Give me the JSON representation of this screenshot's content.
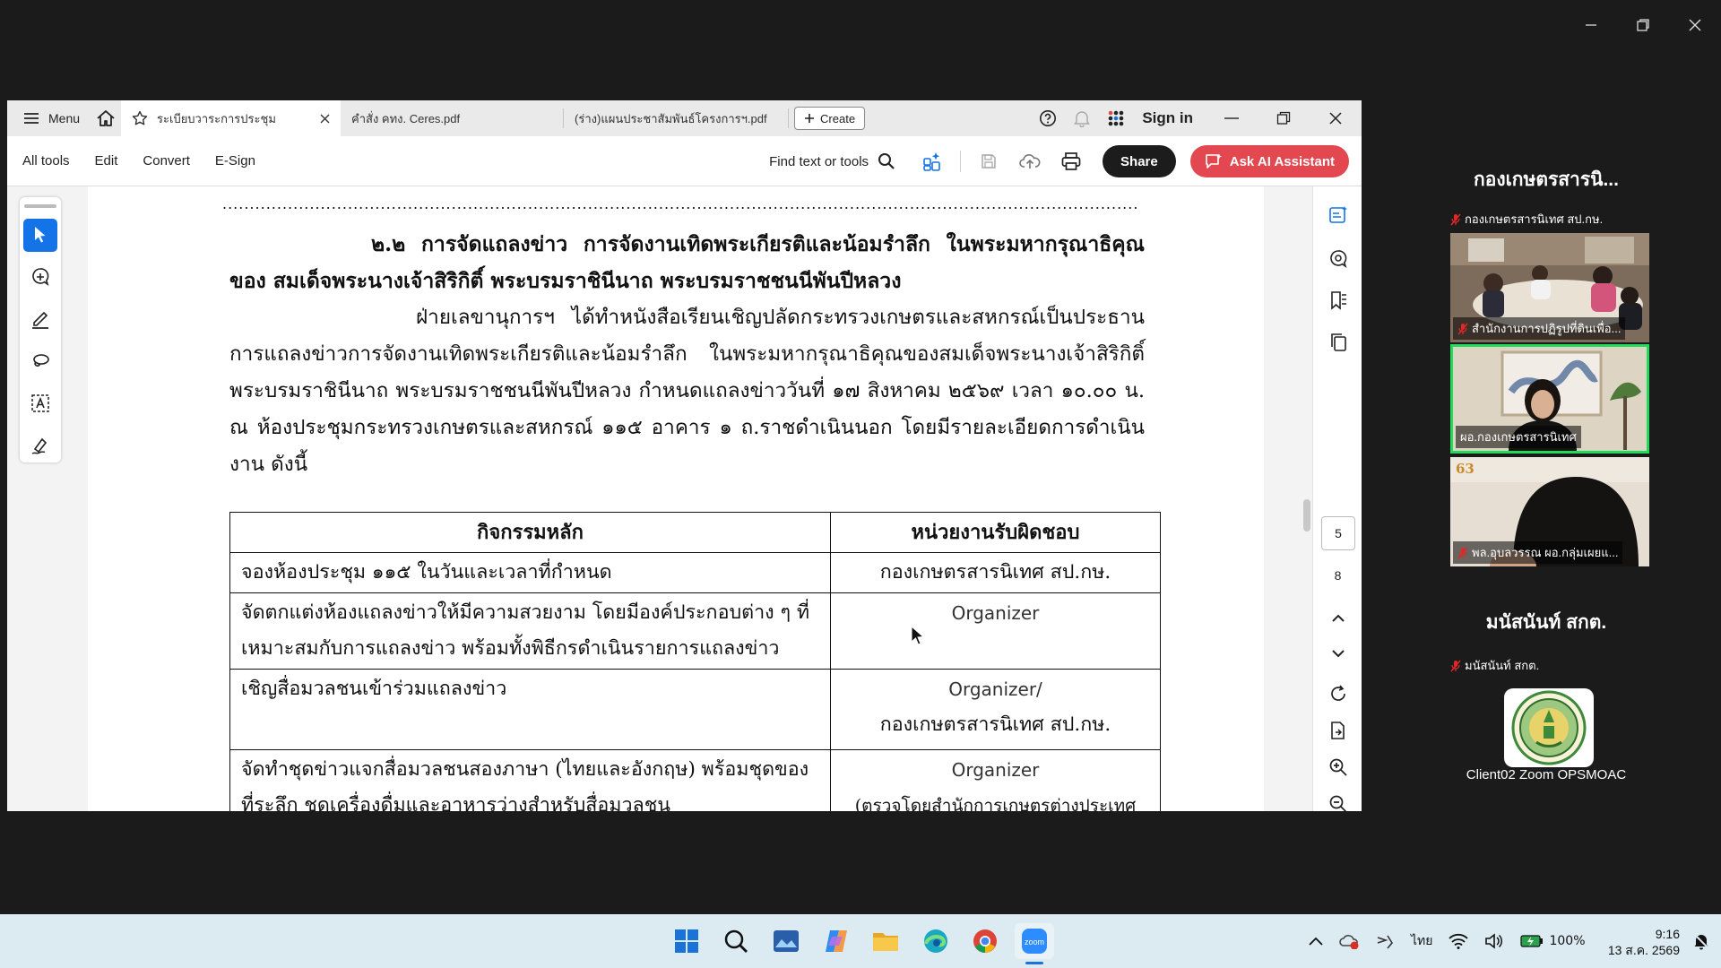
{
  "acrobat": {
    "menu_label": "Menu",
    "tabs": [
      {
        "label": "ระเบียบวาระการประชุม"
      },
      {
        "label": "คำสั่ง คทง. Ceres.pdf"
      },
      {
        "label": "(ร่าง)แผนประชาสัมพันธ์โครงการฯ.pdf"
      }
    ],
    "create_label": "Create",
    "signin_label": "Sign in",
    "menus": [
      "All tools",
      "Edit",
      "Convert",
      "E-Sign"
    ],
    "find_label": "Find text or tools",
    "share_label": "Share",
    "ask_ai_label": "Ask AI Assistant",
    "page_current": "5",
    "page_total": "8"
  },
  "document": {
    "dots": "..........................................................................................................................................................................................................",
    "heading": "๒.๒ การจัดแถลงข่าว การจัดงานเทิดพระเกียรติและน้อมรำลึก ในพระมหากรุณาธิคุณของ สมเด็จพระนางเจ้าสิริกิติ์ พระบรมราชินีนาถ พระบรมราชชนนีพันปีหลวง",
    "paragraph": "ฝ่ายเลขานุการฯ ได้ทำหนังสือเรียนเชิญปลัดกระทรวงเกษตรและสหกรณ์เป็นประธานการแถลงข่าวการจัดงานเทิดพระเกียรติและน้อมรำลึก ในพระมหากรุณาธิคุณของสมเด็จพระนางเจ้าสิริกิติ์ พระบรมราชินีนาถ พระบรมราชชนนีพันปีหลวง กำหนดแถลงข่าววันที่ ๑๗ สิงหาคม ๒๕๖๙ เวลา ๑๐.๐๐ น. ณ ห้องประชุมกระทรวงเกษตรและสหกรณ์ ๑๑๕ อาคาร ๑ ถ.ราชดำเนินนอก โดยมีรายละเอียดการดำเนินงาน ดังนี้",
    "table": {
      "headers": [
        "กิจกรรมหลัก",
        "หน่วยงานรับผิดชอบ"
      ],
      "rows": [
        {
          "activity": "จองห้องประชุม ๑๑๕ ในวันและเวลาที่กำหนด",
          "owner": "กองเกษตรสารนิเทศ สป.กษ."
        },
        {
          "activity": "จัดตกแต่งห้องแถลงข่าวให้มีความสวยงาม โดยมีองค์ประกอบต่าง ๆ ที่เหมาะสมกับการแถลงข่าว พร้อมทั้งพิธีกรดำเนินรายการแถลงข่าว",
          "owner": "Organizer"
        },
        {
          "activity": "เชิญสื่อมวลชนเข้าร่วมแถลงข่าว",
          "owner": "Organizer/",
          "owner2": "กองเกษตรสารนิเทศ สป.กษ."
        },
        {
          "activity": "จัดทำชุดข่าวแจกสื่อมวลชนสองภาษา (ไทยและอังกฤษ) พร้อมชุดของที่ระลึก ชุดเครื่องดื่มและอาหารว่างสำหรับสื่อมวลชน",
          "owner": "Organizer",
          "owner2": "(ตรวจโดยสำนักการเกษตรต่างประเทศ"
        }
      ]
    }
  },
  "zoom": {
    "group1_title": "กองเกษตรสารนิ...",
    "tiles": [
      {
        "name": "กองเกษตรสารนิเทศ สป.กษ."
      },
      {
        "name": "สำนักงานการปฏิรูปที่ดินเพื่อ..."
      },
      {
        "name": "ผอ.กองเกษตรสารนิเทศ"
      },
      {
        "name": "พล.อุบลวรรณ ผอ.กลุ่มเผยแ..."
      }
    ],
    "tile4_banner": "63",
    "group2_title": "มนัสนันท์ สกต.",
    "group2_name": "มนัสนันท์ สกต.",
    "client_label": "Client02 Zoom OPSMOAC"
  },
  "taskbar": {
    "language": "ไทย",
    "battery": "100%",
    "time": "9:16",
    "date": "13 ส.ค. 2569"
  },
  "colors": {
    "accent_blue": "#1473e6",
    "ai_red": "#e34850",
    "active_speaker": "#23d959"
  }
}
